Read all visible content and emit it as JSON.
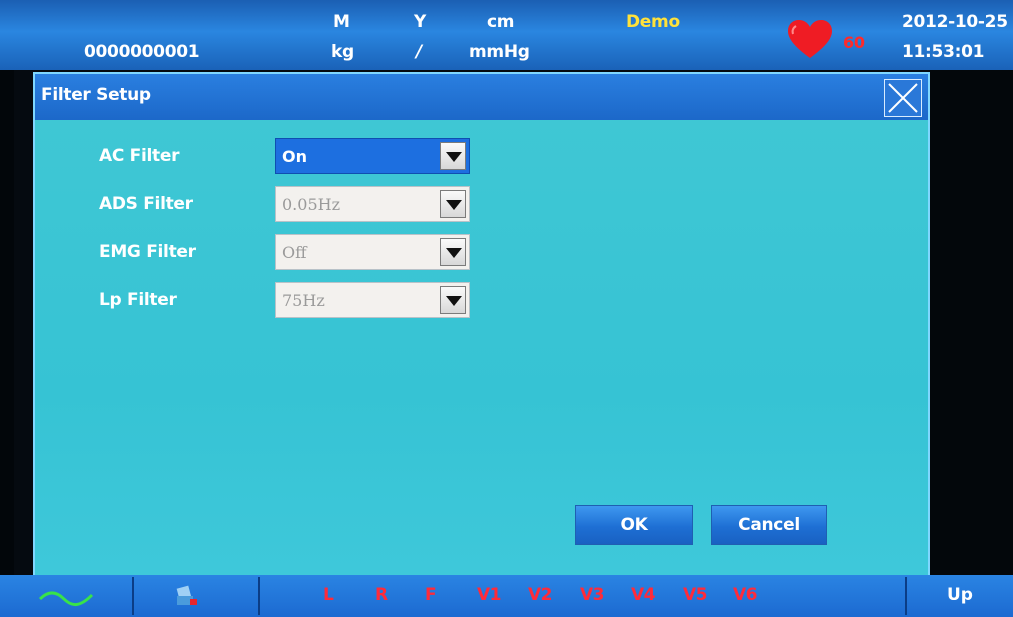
{
  "status_bar": {
    "patient_id": "0000000001",
    "gender": "M",
    "age_unit": "Y",
    "height_unit": "cm",
    "weight_unit": "kg",
    "separator": "/",
    "bp_unit": "mmHg",
    "mode": "Demo",
    "heart_rate": "60",
    "date": "2012-10-25",
    "time": "11:53:01",
    "colors": {
      "mode": "#ffe23a",
      "heart": "#ff2a2a"
    }
  },
  "dialog": {
    "title": "Filter Setup",
    "close_icon": "close-x-icon",
    "filters": [
      {
        "label": "AC Filter",
        "value": "On"
      },
      {
        "label": "ADS Filter",
        "value": "0.05Hz"
      },
      {
        "label": "EMG Filter",
        "value": "Off"
      },
      {
        "label": "Lp Filter",
        "value": "75Hz"
      }
    ],
    "ok_label": "OK",
    "cancel_label": "Cancel"
  },
  "bottom_bar": {
    "waveform_icon": "waveform-icon",
    "print_icon": "printer-icon",
    "leads": [
      "L",
      "R",
      "F",
      "V1",
      "V2",
      "V3",
      "V4",
      "V5",
      "V6"
    ],
    "lead_color": "#ff2b3a",
    "up_label": "Up"
  }
}
